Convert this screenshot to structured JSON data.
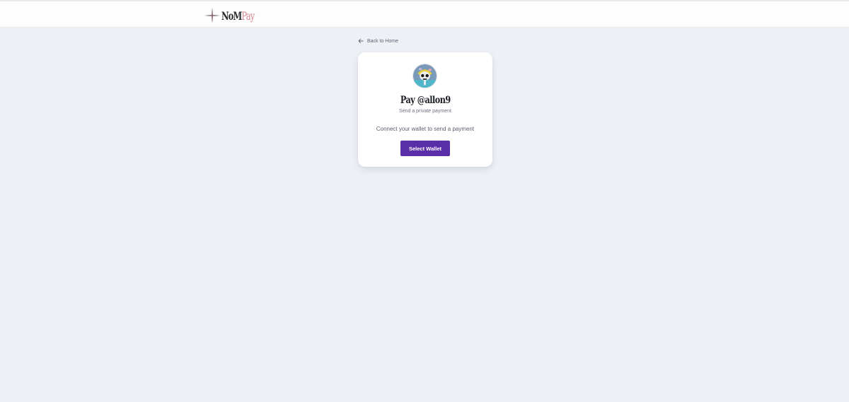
{
  "header": {
    "logo": {
      "text_primary": "NoM",
      "text_accent": "Pay",
      "icon": "sparkle-star-icon"
    }
  },
  "nav": {
    "back_label": "Back to Home",
    "back_icon": "arrow-left-icon"
  },
  "payment_card": {
    "avatar_alt": "allon9 avatar",
    "title": "Pay @allon9",
    "subtitle": "Send a private payment",
    "message": "Connect your wallet to send a payment",
    "button_label": "Select Wallet"
  },
  "colors": {
    "background": "#edf0f5",
    "header_bg": "#fdfdfd",
    "card_bg": "#ffffff",
    "accent": "#5a2ea6",
    "logo_accent": "#d08a96"
  }
}
